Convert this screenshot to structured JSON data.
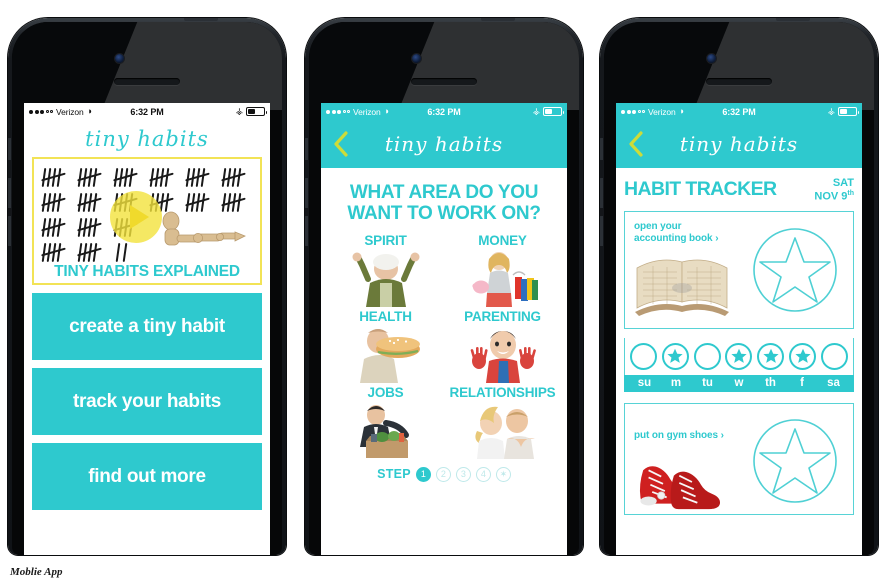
{
  "caption": "Moblie App",
  "colors": {
    "teal": "#2ec9ce",
    "yellow": "#f2e356",
    "chartreuse": "#cddc39",
    "white": "#ffffff"
  },
  "status_bar": {
    "carrier": "Verizon",
    "time": "6:32 PM",
    "signal_dots_filled": 3,
    "signal_dots_empty": 2,
    "wifi_icon": "wifi-icon",
    "bluetooth_icon": "bluetooth-icon",
    "battery_icon": "battery-icon"
  },
  "brand": {
    "wordmark": "tiny habits"
  },
  "screen1": {
    "video_card": {
      "caption": "TINY HABITS EXPLAINED",
      "play_icon": "play-button-icon",
      "tally_rows": [
        6,
        6,
        3,
        3
      ],
      "tally_last_partial": "||"
    },
    "buttons": [
      {
        "label": "create a tiny habit"
      },
      {
        "label": "track your habits"
      },
      {
        "label": "find out more"
      }
    ]
  },
  "screen2": {
    "back_icon": "back-chevron-icon",
    "title": "WHAT AREA DO YOU WANT TO WORK ON?",
    "title_line1": "WHAT AREA DO YOU",
    "title_line2": "WANT TO WORK ON?",
    "areas": [
      {
        "label": "SPIRIT",
        "image": "older-woman-cheering-photo"
      },
      {
        "label": "MONEY",
        "image": "woman-with-piggy-bank-and-shopping-bags-photo"
      },
      {
        "label": "HEALTH",
        "image": "man-eating-large-sandwich-photo"
      },
      {
        "label": "PARENTING",
        "image": "child-with-painted-hands-photo"
      },
      {
        "label": "JOBS",
        "image": "man-carrying-office-box-photo"
      },
      {
        "label": "RELATIONSHIPS",
        "image": "couple-foreheads-together-photo"
      }
    ],
    "stepper": {
      "label": "STEP",
      "steps": [
        "1",
        "2",
        "3",
        "4",
        "✶"
      ],
      "active_index": 0
    }
  },
  "screen3": {
    "back_icon": "back-chevron-icon",
    "title": "HABIT TRACKER",
    "date_day": "SAT",
    "date_month_day": "NOV 9",
    "date_suffix": "th",
    "habits": [
      {
        "link": "open your accounting book",
        "link_line1": "open your",
        "link_line2": "accounting book",
        "chevron": "›",
        "image": "open-ledger-book-photo",
        "star_icon": "star-outline-icon"
      },
      {
        "link": "put on gym shoes",
        "link_line1": "put on gym shoes",
        "link_line2": "",
        "chevron": "›",
        "image": "red-high-top-sneakers-photo",
        "star_icon": "star-outline-icon"
      }
    ],
    "week": {
      "days": [
        "su",
        "m",
        "tu",
        "w",
        "th",
        "f",
        "sa"
      ],
      "completed": [
        false,
        true,
        false,
        true,
        true,
        true,
        false
      ]
    }
  }
}
